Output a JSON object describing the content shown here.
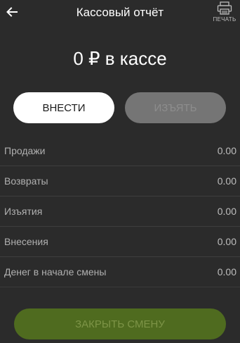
{
  "header": {
    "title": "Кассовый отчёт",
    "back_icon": "arrow-left-icon",
    "print_icon": "printer-icon",
    "print_label": "ПЕЧАТЬ"
  },
  "cash": {
    "amount_text": "0 ₽ в кассе"
  },
  "actions": {
    "deposit_label": "ВНЕСТИ",
    "withdraw_label": "ИЗЪЯТЬ"
  },
  "report": {
    "rows": [
      {
        "label": "Продажи",
        "value": "0.00"
      },
      {
        "label": "Возвраты",
        "value": "0.00"
      },
      {
        "label": "Изъятия",
        "value": "0.00"
      },
      {
        "label": "Внесения",
        "value": "0.00"
      },
      {
        "label": "Денег в начале смены",
        "value": "0.00"
      }
    ]
  },
  "footer": {
    "close_shift_label": "ЗАКРЫТЬ СМЕНУ"
  },
  "colors": {
    "background": "#2b2b2b",
    "deposit_button": "#ffffff",
    "withdraw_button_disabled": "#757575",
    "close_shift_button_disabled": "#4f6b1f"
  }
}
